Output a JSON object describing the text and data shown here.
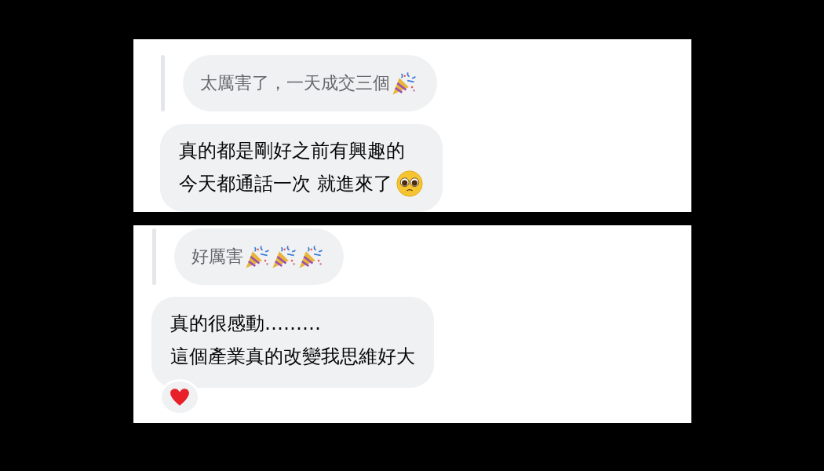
{
  "screenshots": [
    {
      "quoted": {
        "text": "太厲害了，一天成交三個",
        "emojis": [
          {
            "kind": "party"
          }
        ]
      },
      "reply": {
        "lines": [
          {
            "text": "真的都是剛好之前有興趣的"
          },
          {
            "text": "今天都通話一次 就進來了",
            "emojis": [
              {
                "kind": "pleading"
              }
            ]
          }
        ]
      }
    },
    {
      "quoted": {
        "text": "好厲害",
        "emojis": [
          {
            "kind": "party"
          },
          {
            "kind": "party"
          },
          {
            "kind": "party"
          }
        ]
      },
      "reply": {
        "lines": [
          {
            "text": "真的很感動………"
          },
          {
            "text": "這個產業真的改變我思維好大"
          }
        ]
      },
      "reactions": [
        {
          "kind": "heart"
        }
      ]
    }
  ]
}
